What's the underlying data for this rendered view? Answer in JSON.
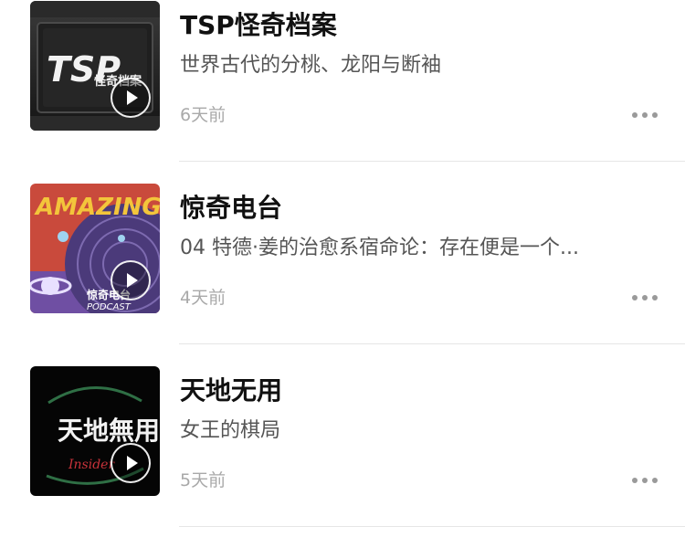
{
  "list": {
    "items": [
      {
        "title": "TSP怪奇档案",
        "subtitle": "世界古代的分桃、龙阳与断袖",
        "time": "6天前",
        "cover_text": "TSP",
        "cover_subtext": "怪奇档案"
      },
      {
        "title": "惊奇电台",
        "subtitle": "04 特德·姜的治愈系宿命论：存在便是一个...",
        "time": "4天前",
        "cover_text": "AMAZING",
        "cover_subtext": "惊奇电台",
        "cover_caption": "PODCAST"
      },
      {
        "title": "天地无用",
        "subtitle": "女王的棋局",
        "time": "5天前",
        "cover_text": "天地無用",
        "cover_subtext": "Insider"
      }
    ]
  },
  "icons": {
    "play": "play-icon",
    "more": "more-icon"
  },
  "colors": {
    "title": "#111111",
    "subtitle": "#555555",
    "time": "#a9a9a9",
    "separator": "#e6e6e6",
    "amazing_bg": "#c94a3c",
    "amazing_circle": "#4b3a7a"
  }
}
